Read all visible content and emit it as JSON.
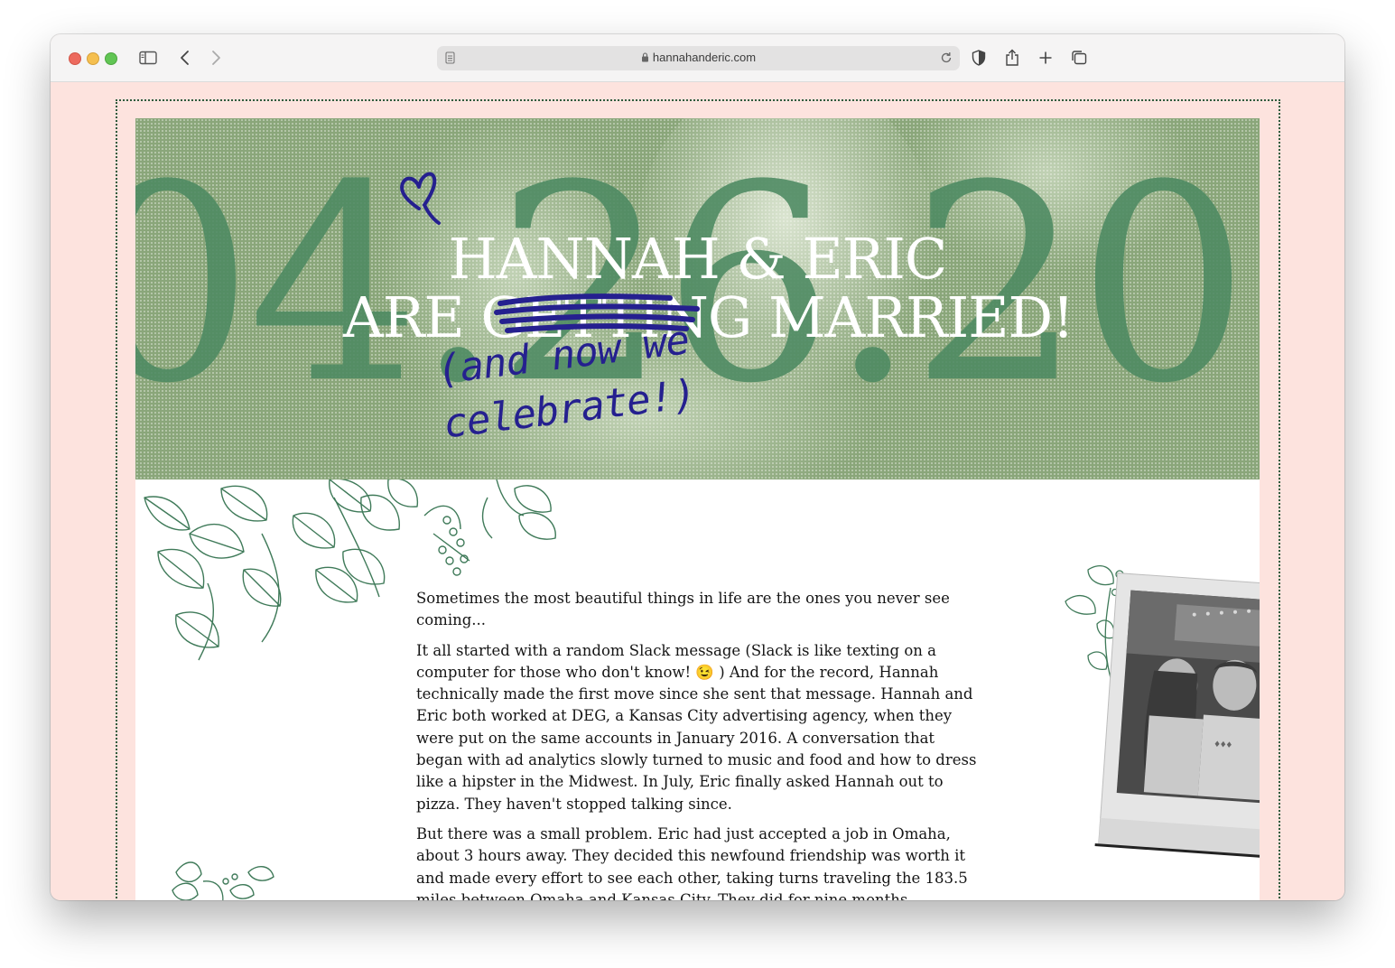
{
  "browser": {
    "url": "hannahanderic.com"
  },
  "hero": {
    "date_digits": [
      "04",
      "26",
      "20"
    ],
    "title_line1": "HANNAH & ERIC",
    "title_are": "ARE",
    "title_struck": "GETTING",
    "title_married": "MARRIED!",
    "handwritten": "(and now we celebrate!)"
  },
  "story": {
    "paragraphs": [
      "Sometimes the most beautiful things in life are the ones you never see coming...",
      "It all started with a random Slack message (Slack is like texting on a computer for those who don't know! 😉 ) And for the record, Hannah technically made the first move since she sent that message. Hannah and Eric both worked at DEG, a Kansas City advertising agency, when they were put on the same accounts in January 2016. A conversation that began with ad analytics slowly turned to music and food and how to dress like a hipster in the Midwest. In July, Eric finally asked Hannah out to pizza. They haven't stopped talking since.",
      "But there was a small problem. Eric had just accepted a job in Omaha, about 3 hours away. They decided this newfound friendship was worth it and made every effort to see each other, taking turns traveling the 183.5 miles between Omaha and Kansas City. They did for nine months..."
    ]
  },
  "colors": {
    "page_bg": "#fde3de",
    "hero_green": "#8aa67a",
    "digit_green": "#4d8a62",
    "ink_blue": "#25208f"
  }
}
